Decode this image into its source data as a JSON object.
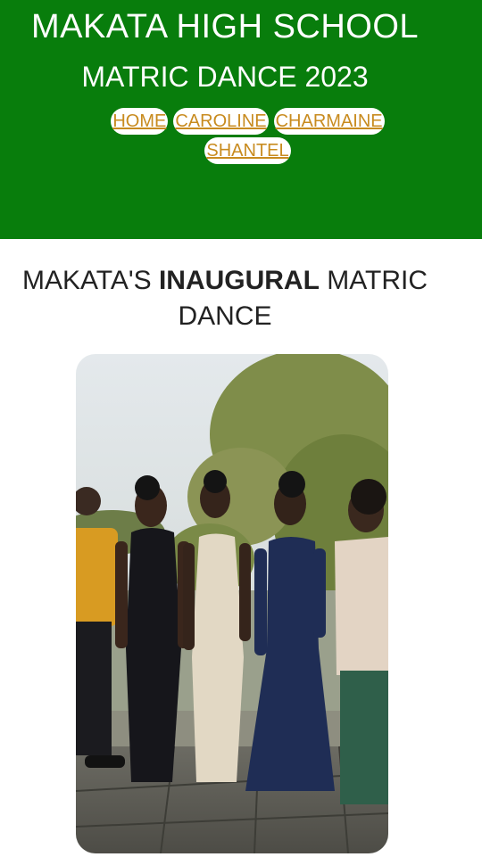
{
  "header": {
    "title": "MAKATA HIGH SCHOOL",
    "subtitle": "MATRIC DANCE 2023",
    "nav": [
      "HOME",
      "CAROLINE",
      "CHARMAINE",
      "SHANTEL"
    ],
    "colors": {
      "background": "#087d0c",
      "link": "#c88b1f"
    }
  },
  "main": {
    "headline_pre": "MAKATA'S ",
    "headline_bold": "INAUGURAL",
    "headline_post": " MATRIC DANCE",
    "photo_icon": "group-photo"
  }
}
